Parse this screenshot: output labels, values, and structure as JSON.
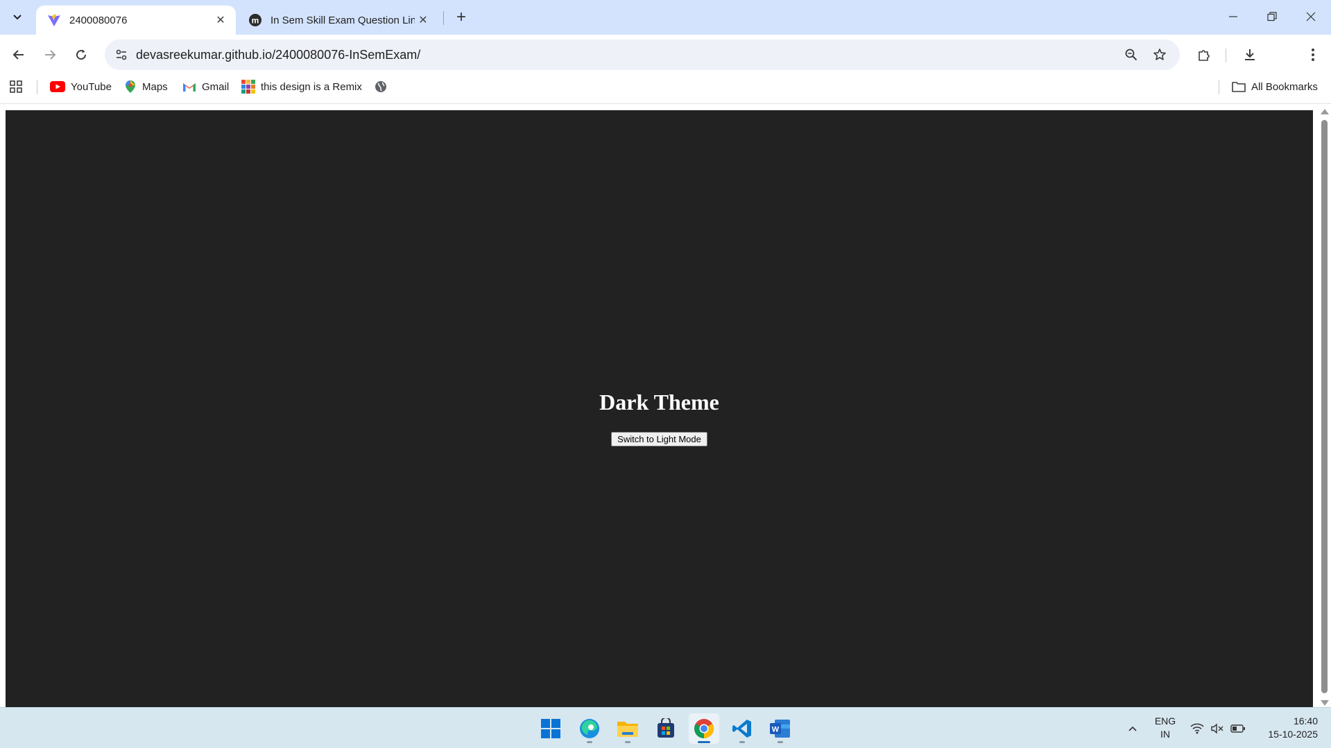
{
  "browser": {
    "tabs": [
      {
        "title": "2400080076",
        "active": true
      },
      {
        "title": "In Sem Skill Exam Question Link",
        "active": false
      }
    ],
    "address_bar": {
      "url": "devasreekumar.github.io/2400080076-InSemExam/"
    },
    "bookmarks": [
      {
        "label": "YouTube",
        "icon": "youtube-icon"
      },
      {
        "label": "Maps",
        "icon": "maps-icon"
      },
      {
        "label": "Gmail",
        "icon": "gmail-icon"
      },
      {
        "label": "this design is a Remix",
        "icon": "remix-icon"
      },
      {
        "label": "",
        "icon": "globe-icon"
      }
    ],
    "all_bookmarks_label": "All Bookmarks"
  },
  "page": {
    "background": "#222222",
    "heading": "Dark Theme",
    "toggle_button": "Switch to Light Mode"
  },
  "taskbar": {
    "apps": [
      "start-icon",
      "edge-icon",
      "file-explorer-icon",
      "store-icon",
      "chrome-icon",
      "vscode-icon",
      "word-icon"
    ],
    "language_line1": "ENG",
    "language_line2": "IN",
    "time": "16:40",
    "date": "15-10-2025"
  }
}
